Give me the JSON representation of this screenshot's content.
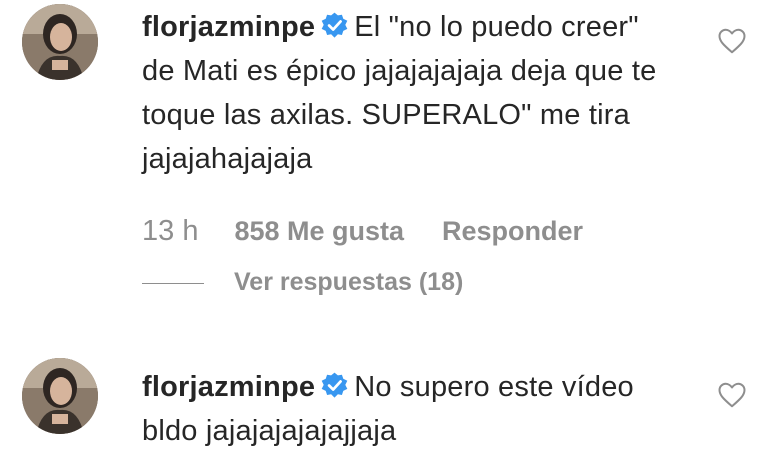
{
  "comments": [
    {
      "username": "florjazminpe",
      "text": "El \"no lo puedo creer\" de Mati es épico jajajajajaja deja que te toque las axilas. SUPERALO\" me tira jajajahajajaja",
      "time": "13 h",
      "likes": "858 Me gusta",
      "reply_label": "Responder",
      "view_replies": "Ver respuestas (18)"
    },
    {
      "username": "florjazminpe",
      "text": "No supero este vídeo bldo jajajajajajajjaja"
    }
  ],
  "icons": {
    "verified": "verified-badge-icon",
    "like": "heart-outline-icon"
  },
  "colors": {
    "verified_blue": "#3897f0",
    "secondary_text": "#8e8e8e",
    "primary_text": "#262626"
  }
}
